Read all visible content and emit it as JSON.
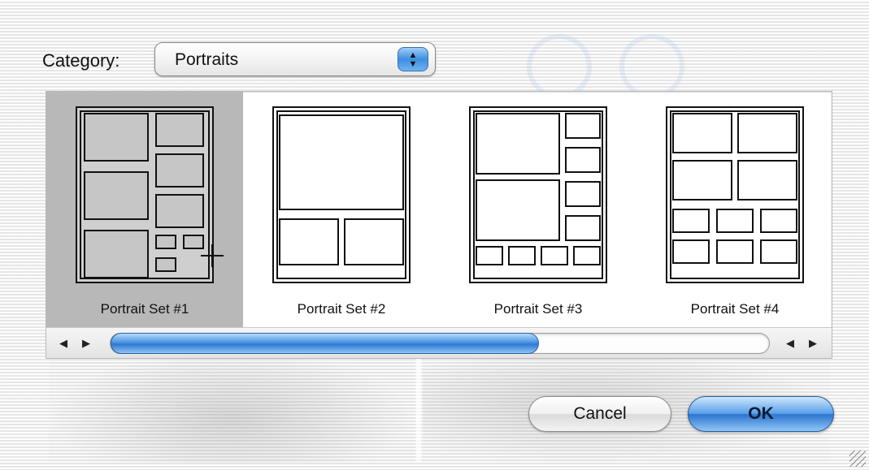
{
  "category": {
    "label": "Category:",
    "selected_value": "Portraits",
    "arrows": "▲\n▼"
  },
  "templates": [
    {
      "label": "Portrait Set #1",
      "selected": true
    },
    {
      "label": "Portrait Set #2",
      "selected": false
    },
    {
      "label": "Portrait Set #3",
      "selected": false
    },
    {
      "label": "Portrait Set #4",
      "selected": false
    }
  ],
  "scrollbar": {
    "left_arrow": "◀",
    "right_arrow": "▶",
    "thumb_fraction": 0.65
  },
  "buttons": {
    "cancel": "Cancel",
    "ok": "OK"
  },
  "colors": {
    "accent": "#2f79d1",
    "selected_tile": "#b8b8b8"
  }
}
